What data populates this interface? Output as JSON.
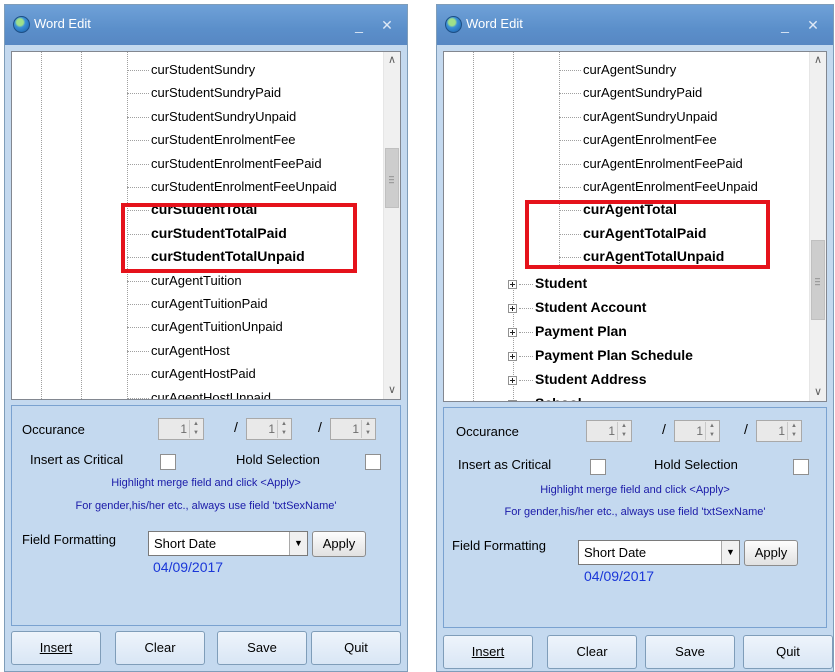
{
  "left_window": {
    "title": "Word Edit",
    "tree_items": [
      {
        "label": "curStudentSundry",
        "bold": false
      },
      {
        "label": "curStudentSundryPaid",
        "bold": false
      },
      {
        "label": "curStudentSundryUnpaid",
        "bold": false
      },
      {
        "label": "curStudentEnrolmentFee",
        "bold": false
      },
      {
        "label": "curStudentEnrolmentFeePaid",
        "bold": false
      },
      {
        "label": "curStudentEnrolmentFeeUnpaid",
        "bold": false
      },
      {
        "label": "curStudentTotal",
        "bold": true
      },
      {
        "label": "curStudentTotalPaid",
        "bold": true
      },
      {
        "label": "curStudentTotalUnpaid",
        "bold": true
      },
      {
        "label": "curAgentTuition",
        "bold": false
      },
      {
        "label": "curAgentTuitionPaid",
        "bold": false
      },
      {
        "label": "curAgentTuitionUnpaid",
        "bold": false
      },
      {
        "label": "curAgentHost",
        "bold": false
      },
      {
        "label": "curAgentHostPaid",
        "bold": false
      },
      {
        "label": "curAgentHostUnpaid",
        "bold": false
      }
    ]
  },
  "right_window": {
    "title": "Word Edit",
    "tree_items": [
      {
        "label": "curAgentSundry",
        "bold": false
      },
      {
        "label": "curAgentSundryPaid",
        "bold": false
      },
      {
        "label": "curAgentSundryUnpaid",
        "bold": false
      },
      {
        "label": "curAgentEnrolmentFee",
        "bold": false
      },
      {
        "label": "curAgentEnrolmentFeePaid",
        "bold": false
      },
      {
        "label": "curAgentEnrolmentFeeUnpaid",
        "bold": false
      },
      {
        "label": "curAgentTotal",
        "bold": true
      },
      {
        "label": "curAgentTotalPaid",
        "bold": true
      },
      {
        "label": "curAgentTotalUnpaid",
        "bold": true
      }
    ],
    "groups": [
      "Student",
      "Student Account",
      "Payment Plan",
      "Payment Plan Schedule",
      "Student Address",
      "School"
    ]
  },
  "form": {
    "occurance_label": "Occurance",
    "occurance_values": [
      "1",
      "1",
      "1"
    ],
    "separator": "/",
    "insert_critical_label": "Insert as Critical",
    "hold_selection_label": "Hold Selection",
    "hint1": "Highlight merge field and click <Apply>",
    "hint2": "For gender,his/her etc., always use field 'txtSexName'",
    "field_formatting_label": "Field Formatting",
    "format_value": "Short Date",
    "apply_label": "Apply",
    "date_preview": "04/09/2017"
  },
  "buttons": {
    "insert": "Insert",
    "clear": "Clear",
    "save": "Save",
    "quit": "Quit"
  },
  "icons": {
    "app": "globe-icon",
    "minimize": "minimize-icon",
    "close": "close-icon"
  },
  "colors": {
    "titlebar": "#5b8fca",
    "panel": "#c4d9ef",
    "highlight": "#e5121b",
    "hint_text": "#1a1aa8",
    "date_text": "#1a37d8"
  }
}
